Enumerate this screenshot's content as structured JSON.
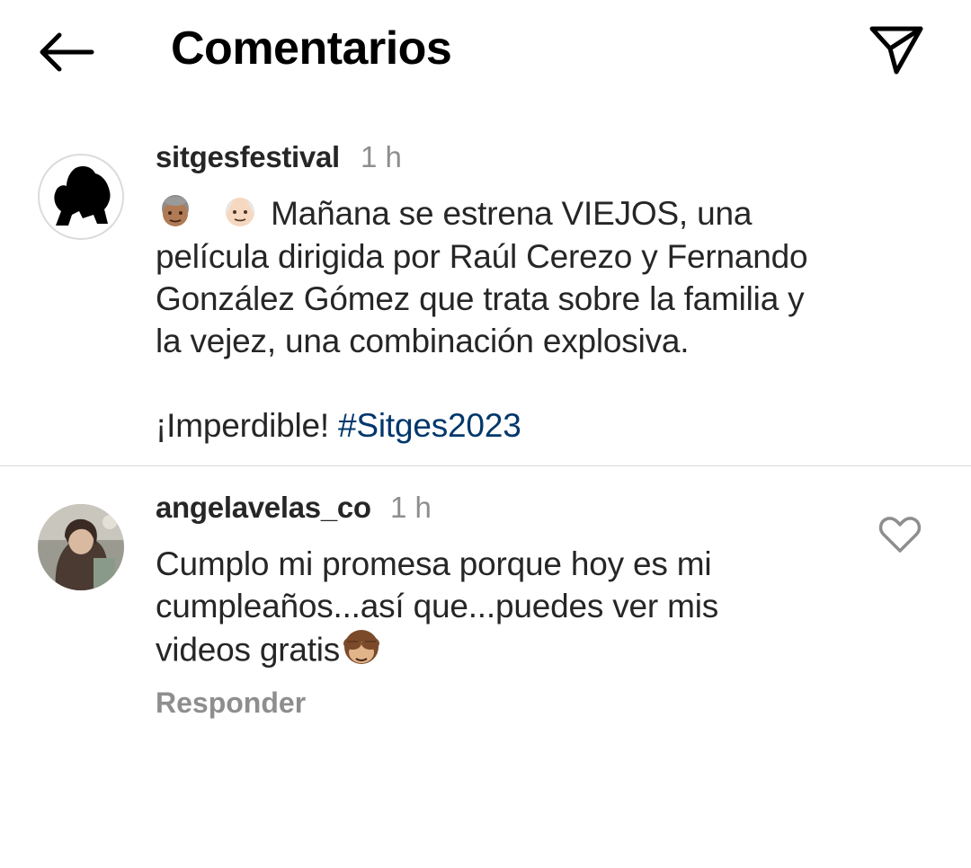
{
  "header": {
    "title": "Comentarios"
  },
  "caption": {
    "username": "sitgesfestival",
    "time": "1 h",
    "emojis": [
      "older-woman-emoji",
      "older-man-emoji"
    ],
    "lines": [
      "Mañana se estrena VIEJOS, una",
      "película dirigida por Raúl Cerezo y Fernando",
      "González Gómez que trata sobre la familia y",
      "la vejez, una combinación explosiva."
    ],
    "closing": "¡Imperdible!",
    "hashtag": "#Sitges2023"
  },
  "comment": {
    "username": "angelavelas_co",
    "time": "1 h",
    "lines": [
      "Cumplo mi promesa porque hoy es mi",
      "cumpleaños...así que...puedes ver mis",
      "videos gratis"
    ],
    "emoji": "see-no-evil-monkey-emoji",
    "reply_label": "Responder"
  },
  "colors": {
    "text": "#262626",
    "muted": "#8e8e8e",
    "hashtag": "#00376b",
    "divider": "#dbdbdb"
  }
}
